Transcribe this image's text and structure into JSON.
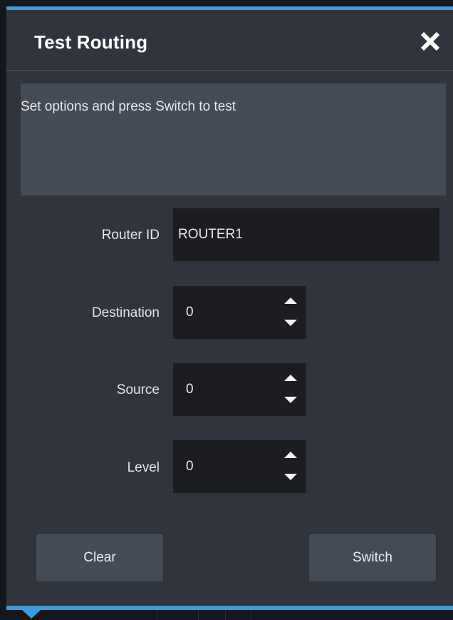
{
  "dialog": {
    "title": "Test Routing",
    "close_icon": "close-icon",
    "message": "Set options and press Switch to test"
  },
  "form": {
    "router_id": {
      "label": "Router ID",
      "value": "ROUTER1"
    },
    "destination": {
      "label": "Destination",
      "value": "0"
    },
    "source": {
      "label": "Source",
      "value": "0"
    },
    "level": {
      "label": "Level",
      "value": "0"
    }
  },
  "buttons": {
    "clear": "Clear",
    "switch": "Switch"
  },
  "colors": {
    "accent": "#3f9be0",
    "dialog_background": "#30353d",
    "panel": "#454b56",
    "input_background": "#1b1d21"
  }
}
